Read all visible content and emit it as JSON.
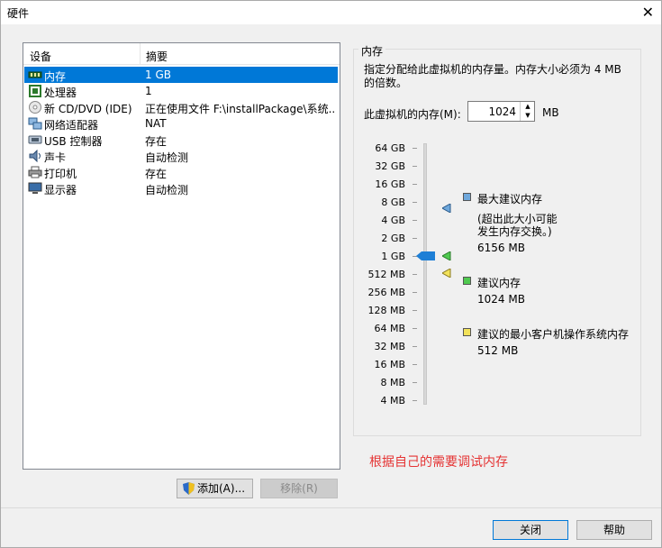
{
  "window": {
    "title": "硬件",
    "close_glyph": "✕"
  },
  "device_list": {
    "headers": {
      "device": "设备",
      "summary": "摘要"
    },
    "rows": [
      {
        "name": "内存",
        "summary": "1 GB",
        "icon": "memory-icon",
        "selected": true
      },
      {
        "name": "处理器",
        "summary": "1",
        "icon": "processor-icon"
      },
      {
        "name": "新 CD/DVD (IDE)",
        "summary": "正在使用文件 F:\\installPackage\\系统...",
        "icon": "cd-dvd-icon"
      },
      {
        "name": "网络适配器",
        "summary": "NAT",
        "icon": "network-adapter-icon"
      },
      {
        "name": "USB 控制器",
        "summary": "存在",
        "icon": "usb-controller-icon"
      },
      {
        "name": "声卡",
        "summary": "自动检测",
        "icon": "sound-card-icon"
      },
      {
        "name": "打印机",
        "summary": "存在",
        "icon": "printer-icon"
      },
      {
        "name": "显示器",
        "summary": "自动检测",
        "icon": "display-icon"
      }
    ]
  },
  "memory": {
    "group_title": "内存",
    "description": "指定分配给此虚拟机的内存量。内存大小必须为 4 MB 的倍数。",
    "field_label": "此虚拟机的内存(M):",
    "value": "1024",
    "unit": "MB",
    "scale": [
      "64 GB",
      "32 GB",
      "16 GB",
      "8 GB",
      "4 GB",
      "2 GB",
      "1 GB",
      "512 MB",
      "256 MB",
      "128 MB",
      "64 MB",
      "32 MB",
      "16 MB",
      "8 MB",
      "4 MB"
    ],
    "slider_value": "1 GB",
    "legend": {
      "max_title": "最大建议内存",
      "max_note_1": "(超出此大小可能",
      "max_note_2": "发生内存交换。)",
      "max_value": "6156 MB",
      "rec_title": "建议内存",
      "rec_value": "1024 MB",
      "min_title": "建议的最小客户机操作系统内存",
      "min_value": "512 MB"
    },
    "colors": {
      "max": "#6fa8dc",
      "rec": "#4fc94f",
      "min": "#f2e25a"
    }
  },
  "note": "根据自己的需要调试内存",
  "buttons": {
    "add": "添加(A)...",
    "remove": "移除(R)",
    "close": "关闭",
    "help": "帮助"
  }
}
